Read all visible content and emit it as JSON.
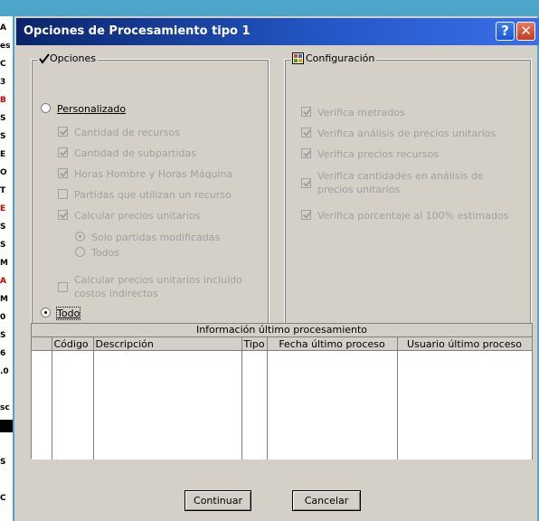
{
  "background_strip": [
    "A",
    "es",
    "C",
    "3",
    "B",
    "S",
    "S",
    "E",
    "O",
    "T",
    "E",
    "S",
    "S",
    "M",
    "A",
    "M",
    "0",
    "S",
    "6",
    ".0",
    "",
    "sc",
    "",
    "",
    "S",
    "",
    "C"
  ],
  "dialog": {
    "title": "Opciones de Procesamiento tipo 1",
    "help_symbol": "?",
    "close_symbol": "✕"
  },
  "opciones": {
    "legend": "Opciones",
    "legend_icon": "checkmark-icon",
    "personalizado": "Personalizado",
    "items": [
      {
        "label": "Cantidad de recursos",
        "checked": true
      },
      {
        "label": "Cantidad de subpartidas",
        "checked": true
      },
      {
        "label": "Horas Hombre y Horas Máquina",
        "checked": true
      },
      {
        "label": "Partidas que utilizan un recurso",
        "checked": false
      },
      {
        "label": "Calcular precios unitarios",
        "checked": true
      }
    ],
    "sub_radio_1": "Solo partidas modificadas",
    "sub_radio_2": "Todos",
    "costos_line1": "Calcular precios unitarios incluido",
    "costos_line2": "costos indirectos",
    "todo": "Todo",
    "selected": "Todo"
  },
  "configuracion": {
    "legend": "Configuración",
    "legend_icon": "config-grid-icon",
    "items": [
      {
        "label": "Verifica metrados",
        "checked": true
      },
      {
        "label": "Verifica análisis de precios unitarios",
        "checked": true
      },
      {
        "label": "Verifica precios recursos",
        "checked": true
      }
    ],
    "cantidades_line1": "Verifica cantidades en análisis de",
    "cantidades_line2": "precios unitarios",
    "porcentaje": "Verifica porcentaje al 100% estimados"
  },
  "info": {
    "title": "Información último procesamiento",
    "columns": [
      "",
      "Código",
      "Descripción",
      "Tipo",
      "Fecha último proceso",
      "Usuario último proceso"
    ]
  },
  "buttons": {
    "continuar": "Continuar",
    "cancelar": "Cancelar"
  },
  "colors": {
    "titlebar_start": "#0a246a",
    "titlebar_end": "#3a6ee8",
    "dialog_face": "#d4d0c8",
    "disabled_text": "#a0a0a0"
  }
}
